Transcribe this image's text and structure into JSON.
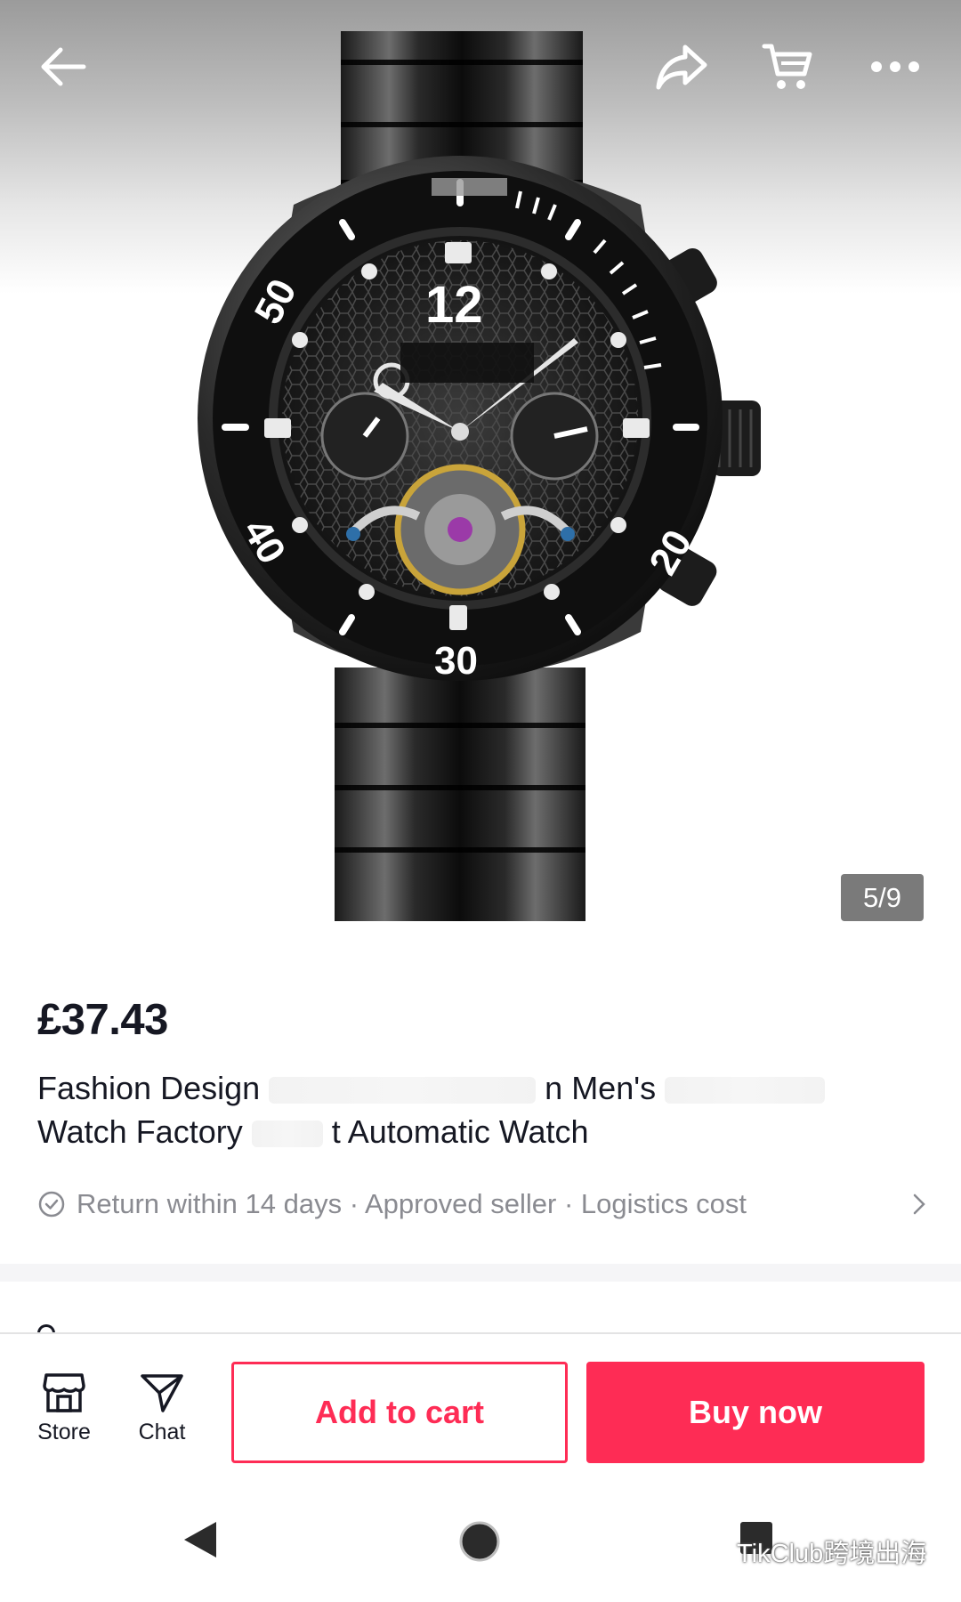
{
  "header": {
    "back_icon": "arrow-left-icon",
    "share_icon": "share-arrow-icon",
    "cart_icon": "shopping-cart-icon",
    "more_icon": "more-dots-icon"
  },
  "gallery": {
    "counter": "5/9",
    "dial_numbers": [
      "12",
      "20",
      "30",
      "40",
      "50"
    ]
  },
  "product": {
    "price": "£37.43",
    "title_line1_a": "Fashion Design",
    "title_line1_b": "n Men's",
    "title_line2_a": "Watch Factory",
    "title_line2_b": "t Automatic Watch",
    "services": "Return within 14 days · Approved seller · Logistics cost"
  },
  "actions": {
    "store_label": "Store",
    "chat_label": "Chat",
    "add_to_cart_label": "Add to cart",
    "buy_now_label": "Buy now"
  },
  "navbar": {
    "watermark": "TikClub跨境出海"
  },
  "colors": {
    "accent": "#fe2c55",
    "text_primary": "#161823",
    "text_secondary": "#8a8b91"
  }
}
